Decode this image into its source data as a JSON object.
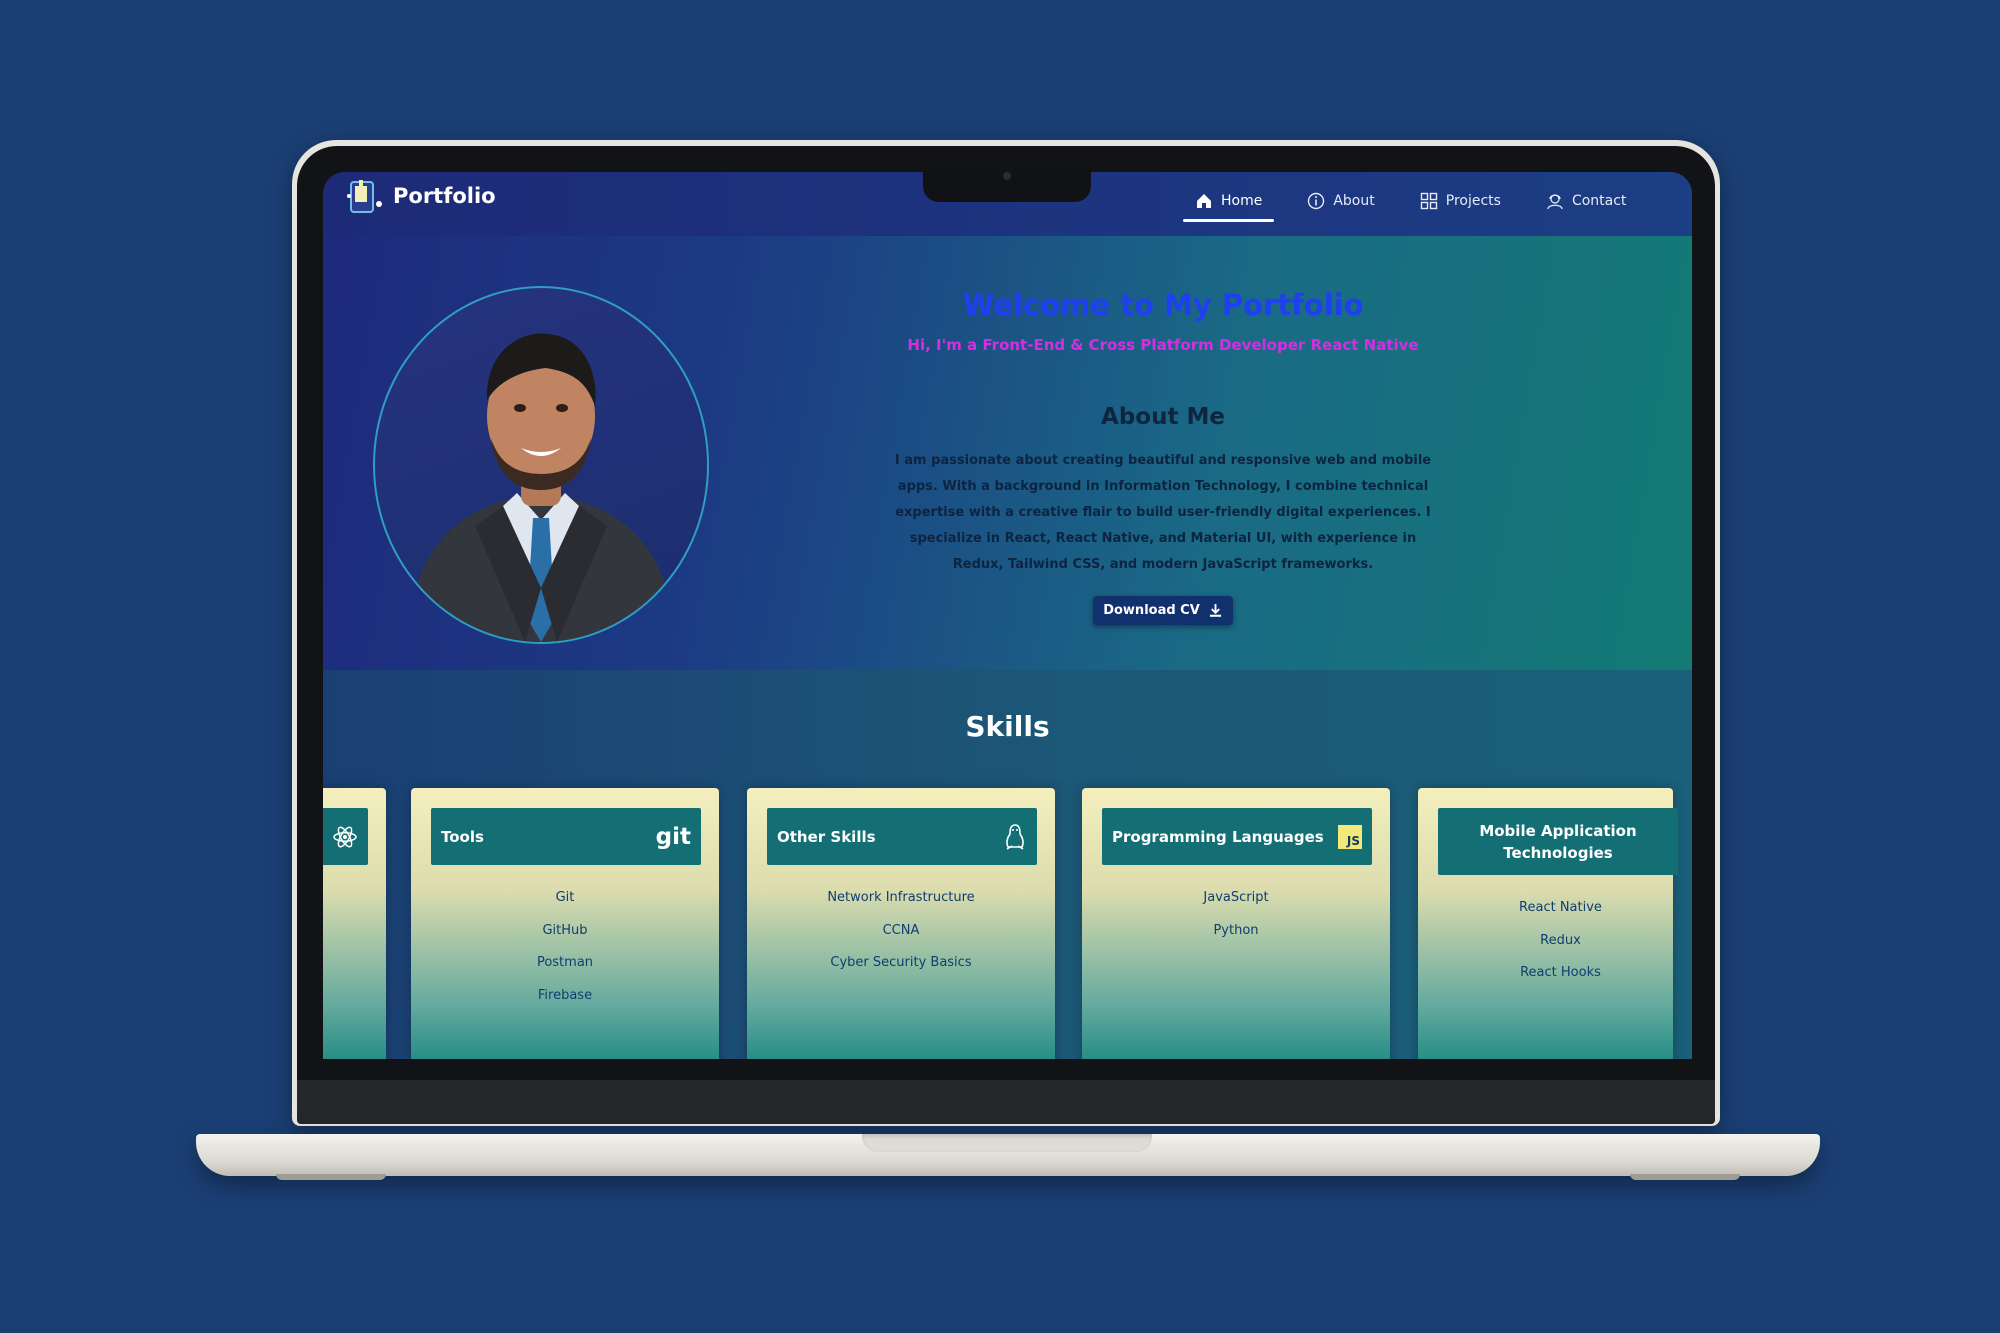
{
  "navbar": {
    "logo_text": "Portfolio",
    "items": [
      {
        "label": "Home",
        "icon": "home-icon",
        "active": true
      },
      {
        "label": "About",
        "icon": "info-icon"
      },
      {
        "label": "Projects",
        "icon": "grid-icon"
      },
      {
        "label": "Contact",
        "icon": "contact-icon"
      }
    ]
  },
  "hero": {
    "title": "Welcome to My Portfolio",
    "subtitle": "Hi, I'm a Front-End & Cross Platform Developer React Native",
    "about_heading": "About Me",
    "about_text": "I am passionate about creating beautiful and responsive web and mobile apps. With a background in Information Technology, I combine technical expertise with a creative flair to build user-friendly digital experiences. I specialize in React, React Native, and Material UI, with experience in Redux, Tailwind CSS, and modern JavaScript frameworks.",
    "cv_button": "Download CV"
  },
  "skills": {
    "title": "Skills",
    "cards": [
      {
        "title": "Tools",
        "logo": "git",
        "items": [
          "Git",
          "GitHub",
          "Postman",
          "Firebase"
        ]
      },
      {
        "title": "Other Skills",
        "icon": "linux-icon",
        "items": [
          "Network Infrastructure",
          "CCNA",
          "Cyber Security Basics"
        ]
      },
      {
        "title": "Programming Languages",
        "logo": "JS",
        "items": [
          "JavaScript",
          "Python"
        ]
      },
      {
        "title": "Mobile Application Technologies",
        "items": [
          "React Native",
          "Redux",
          "React Hooks"
        ]
      }
    ],
    "partial_card_icon": "react-icon"
  },
  "colors": {
    "page_background": "#1b3f75",
    "title": "#1e3ff2",
    "subtitle": "#d42ee2",
    "card_header": "#136f74"
  }
}
